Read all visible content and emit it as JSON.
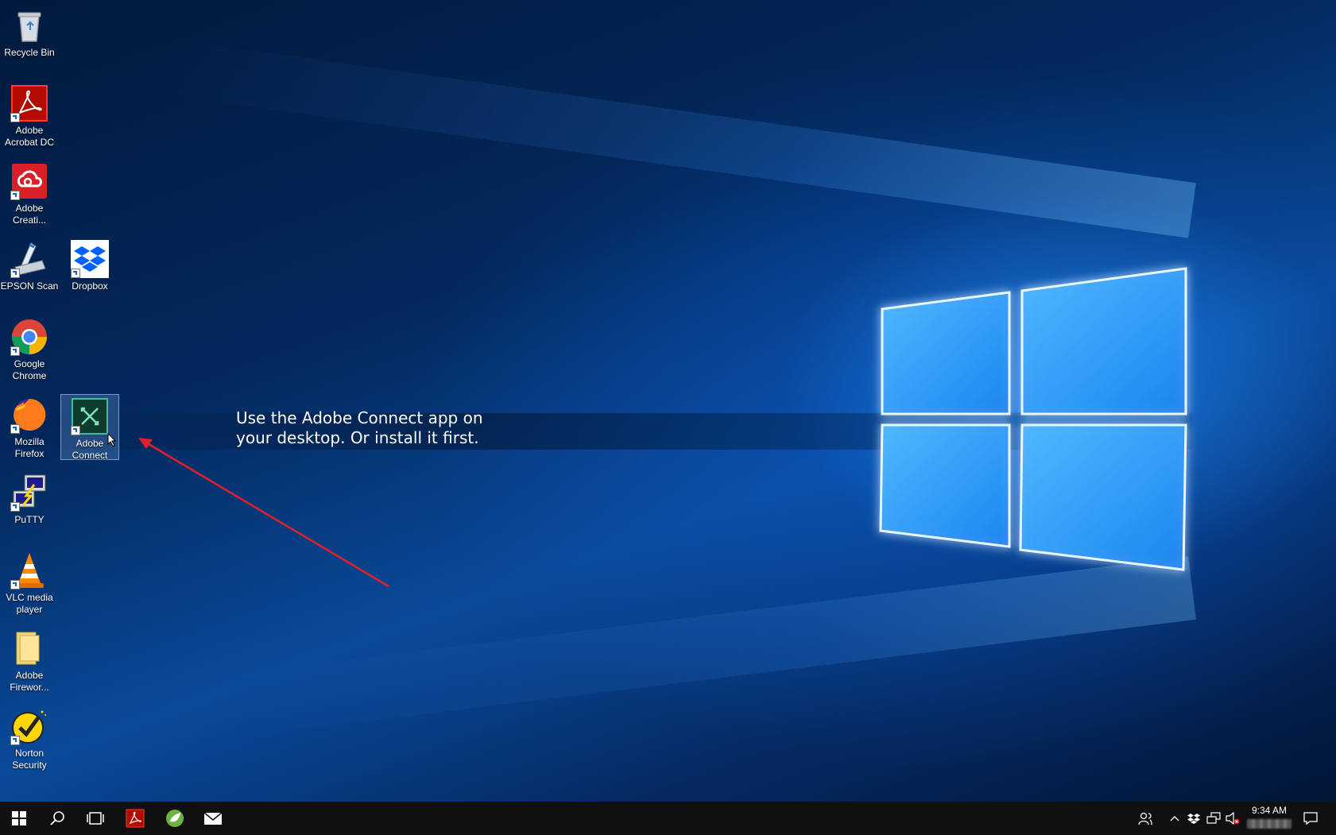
{
  "desktop": {
    "icons": [
      {
        "label": "Recycle Bin",
        "icon": "recycle-bin-icon"
      },
      {
        "label": "Adobe\nAcrobat DC",
        "icon": "adobe-acrobat-icon"
      },
      {
        "label": "Adobe\nCreati...",
        "icon": "adobe-creative-cloud-icon"
      },
      {
        "label": "EPSON Scan",
        "icon": "epson-scan-icon"
      },
      {
        "label": "Dropbox",
        "icon": "dropbox-icon"
      },
      {
        "label": "Google\nChrome",
        "icon": "chrome-icon"
      },
      {
        "label": "Mozilla\nFirefox",
        "icon": "firefox-icon"
      },
      {
        "label": "Adobe\nConnect",
        "icon": "adobe-connect-icon"
      },
      {
        "label": "PuTTY",
        "icon": "putty-icon"
      },
      {
        "label": "VLC media\nplayer",
        "icon": "vlc-icon"
      },
      {
        "label": "Adobe\nFirewor...",
        "icon": "folder-icon"
      },
      {
        "label": "Norton\nSecurity",
        "icon": "norton-icon"
      }
    ],
    "selected_icon": "Adobe Connect"
  },
  "annotation": {
    "text": "Use the Adobe Connect app on\nyour desktop. Or install it first.",
    "arrow_color": "#e0202a"
  },
  "taskbar": {
    "buttons": [
      "start-icon",
      "search-icon",
      "task-view-icon",
      "adobe-acrobat-icon",
      "spring-app-icon",
      "mail-icon"
    ],
    "tray": [
      "people-icon",
      "chevron-up-icon",
      "dropbox-icon",
      "network-icon",
      "volume-muted-icon"
    ],
    "time": "9:34 AM",
    "notification": "action-center-icon"
  },
  "colors": {
    "taskbar_bg": "#101010",
    "wallpaper_accent": "#2a9cff"
  }
}
